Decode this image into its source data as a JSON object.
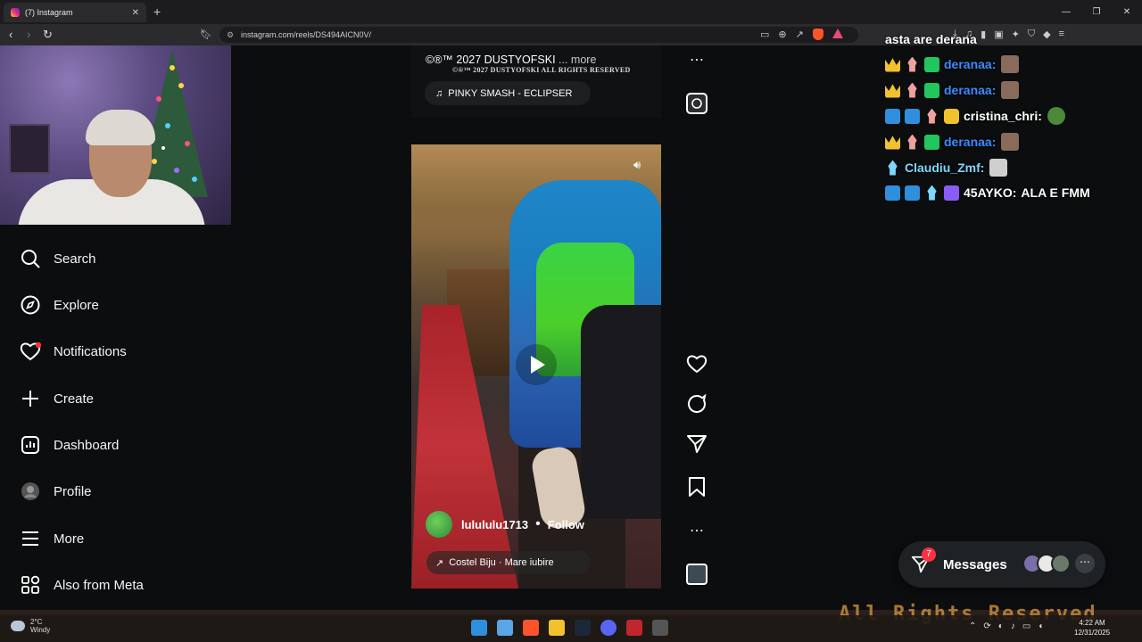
{
  "browser": {
    "tab_title": "(7) Instagram",
    "url": "instagram.com/reels/DS494AICN0V/"
  },
  "sidebar": {
    "items": [
      {
        "label": "Search",
        "icon": "search-icon"
      },
      {
        "label": "Explore",
        "icon": "compass-icon"
      },
      {
        "label": "Notifications",
        "icon": "heart-icon"
      },
      {
        "label": "Create",
        "icon": "plus-icon"
      },
      {
        "label": "Dashboard",
        "icon": "chart-icon"
      },
      {
        "label": "Profile",
        "icon": "avatar-icon"
      },
      {
        "label": "More",
        "icon": "hamburger-icon"
      },
      {
        "label": "Also from Meta",
        "icon": "grid-icon"
      }
    ]
  },
  "reel_prev": {
    "caption": "©®™ 2027 DUSTYOFSKI",
    "caption_more": "... more",
    "caption_small": "©®™ 2027 DUSTYOFSKI ALL RIGHTS RESERVED",
    "audio": "PINKY SMASH - ECLIPSER"
  },
  "reel": {
    "username": "lulululu1713",
    "separator": "•",
    "follow_label": "Follow",
    "audio": "Costel Biju · Mare iubire"
  },
  "chat": {
    "top": "asta are derana",
    "lines": [
      {
        "user": "deranaa:",
        "color": "#3b8cff",
        "badges": [
          "crown",
          "chess",
          "gift"
        ],
        "text": ""
      },
      {
        "user": "deranaa:",
        "color": "#3b8cff",
        "badges": [
          "crown",
          "chess",
          "gift"
        ],
        "text": ""
      },
      {
        "user": "cristina_chri:",
        "color": "#ffffff",
        "badges": [
          "tool",
          "blue",
          "chess",
          "gold"
        ],
        "text": ""
      },
      {
        "user": "deranaa:",
        "color": "#3b8cff",
        "badges": [
          "crown",
          "chess",
          "gift"
        ],
        "text": ""
      },
      {
        "user": "Claudiu_Zmf:",
        "color": "#7ed6ff",
        "badges": [
          "chess"
        ],
        "text": ""
      },
      {
        "user": "45AYKO:",
        "color": "#ffffff",
        "badges": [
          "tool",
          "blue",
          "chess",
          "purple"
        ],
        "text": "ALA E FMM"
      }
    ]
  },
  "messages": {
    "label": "Messages",
    "count": "7"
  },
  "taskbar": {
    "temp": "2°C",
    "condition": "Windy",
    "time": "4:22 AM",
    "date": "12/31/2025"
  },
  "overlay": {
    "text": "All Rights Reserved"
  }
}
